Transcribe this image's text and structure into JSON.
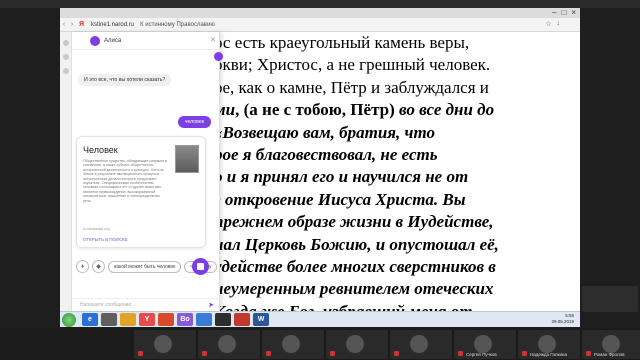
{
  "browser": {
    "url": "kstine1.narod.ru",
    "page_title": "К истинному Православию",
    "logo": "Я"
  },
  "content": {
    "lines": [
      {
        "parts": [
          {
            "t": "ос есть краеугольный камень веры,",
            "s": ""
          }
        ]
      },
      {
        "parts": [
          {
            "t": "ркви; Христос, а не грешный человек.",
            "s": ""
          }
        ]
      },
      {
        "parts": [
          {
            "t": "ре, как о камне, Пётр и заблуждался и",
            "s": ""
          }
        ]
      },
      {
        "parts": [
          {
            "t": "ми",
            "s": "bi"
          },
          {
            "t": ", (а не с тобою, Пётр) ",
            "s": "b"
          },
          {
            "t": "во все дни до",
            "s": "bi"
          }
        ]
      },
      {
        "parts": [
          {
            "t": "«Возвещаю вам, братия, что",
            "s": "bi"
          }
        ]
      },
      {
        "parts": [
          {
            "t": "рое я благовествовал, не есть",
            "s": "bi"
          }
        ]
      },
      {
        "parts": [
          {
            "t": "о и я принял его и научился не от",
            "s": "bi"
          }
        ]
      },
      {
        "parts": [
          {
            "t": "з откровение Иисуса Христа. Вы",
            "s": "bi"
          }
        ]
      },
      {
        "parts": [
          {
            "t": " прежнем образе жизни в Иудействе,",
            "s": "bi"
          }
        ]
      },
      {
        "parts": [
          {
            "t": "нал Церковь Божию, и опустошал её,",
            "s": "bi"
          }
        ]
      },
      {
        "parts": [
          {
            "t": "удействе более многих сверстников в",
            "s": "bi"
          }
        ]
      },
      {
        "parts": [
          {
            "t": " неумеренным ревнителем отеческих",
            "s": "bi"
          }
        ]
      },
      {
        "parts": [
          {
            "t": "Когда же Бог, избравший меня от",
            "s": "bi"
          }
        ]
      }
    ]
  },
  "alice": {
    "name": "Алиса",
    "greeting": "И это все, что вы хотели сказать?",
    "user_message": "человек",
    "card": {
      "title": "Человек",
      "text": "Общественное существо, обладающее разумом и сознанием, а также субъект общественно-исторической деятельности и культуры. Хотя на Земле в результате эволюционного процесса ... антропогенеза делали которого продолжает изучаться. Специфическим особенностям человека относящихся его от других животных является прямохождение, высокоразвитый головной мозг, мышление и членораздельная речь.",
      "source": "ru.wikipedia.org",
      "link": "ОТКРЫТЬ В ПОИСКЕ"
    },
    "chips": [
      "какой может быть человек",
      "человеку"
    ],
    "input_placeholder": "Напишите сообщение..."
  },
  "taskbar": {
    "icons": [
      {
        "label": "e",
        "color": "#2a6fd6"
      },
      {
        "label": "",
        "color": "#5f5f5f"
      },
      {
        "label": "",
        "color": "#e0a526"
      },
      {
        "label": "Y",
        "color": "#e84b4b"
      },
      {
        "label": "",
        "color": "#d84a2a"
      },
      {
        "label": "Bo",
        "color": "#8a5ad8"
      },
      {
        "label": "",
        "color": "#3a7bd5"
      },
      {
        "label": "",
        "color": "#2e2e2e"
      },
      {
        "label": "",
        "color": "#c0392b"
      },
      {
        "label": "W",
        "color": "#2b5797"
      }
    ],
    "time": "5:55",
    "date": "29.05.2019"
  },
  "participants": [
    {
      "name": ""
    },
    {
      "name": ""
    },
    {
      "name": ""
    },
    {
      "name": ""
    },
    {
      "name": ""
    },
    {
      "name": "Сергей Пучков"
    },
    {
      "name": "Надежда Галкина"
    },
    {
      "name": "Роман Фролов"
    }
  ]
}
